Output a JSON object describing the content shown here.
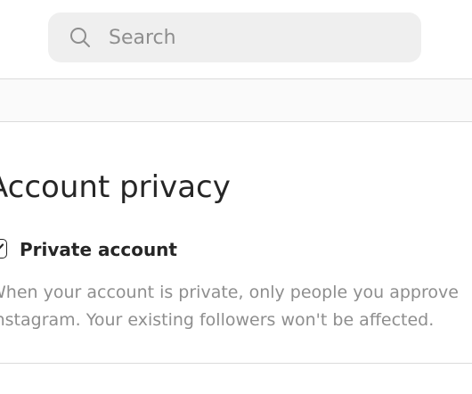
{
  "search": {
    "placeholder": "Search",
    "value": "",
    "icon": "search-icon"
  },
  "privacy": {
    "title": "Account privacy",
    "checkbox_label": "Private account",
    "checkbox_checked": true,
    "description_line1": "When your account is private, only people you approve",
    "description_line2": "Instagram. Your existing followers won't be affected."
  },
  "colors": {
    "text": "#262626",
    "secondary_text": "#8e8e8e",
    "search_bg": "#efefef",
    "divider": "#dbdbdb"
  }
}
